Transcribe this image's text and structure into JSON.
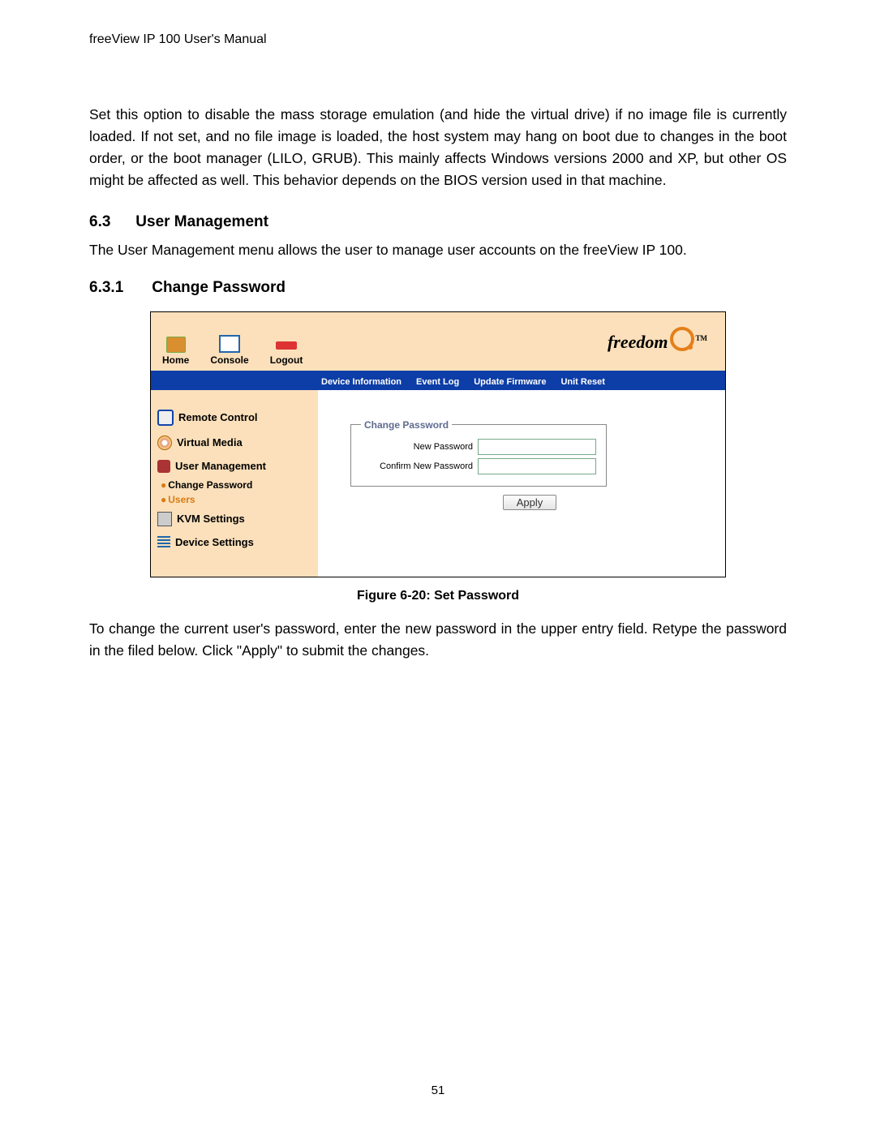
{
  "doc_header": "freeView IP 100 User's Manual",
  "para_intro": "Set this option to disable the mass storage emulation (and hide the virtual drive) if no image file is currently loaded. If not set, and no file image is loaded, the host system may hang on boot due to changes in the boot order, or the boot manager (LILO, GRUB). This mainly affects Windows versions 2000 and XP, but other OS might be affected as well. This behavior depends on the BIOS version used in that machine.",
  "section_63_num": "6.3",
  "section_63_title": "User Management",
  "para_63": "The User Management menu allows the user to manage user accounts on the freeView IP 100.",
  "section_631_num": "6.3.1",
  "section_631_title": "Change Password",
  "app": {
    "header_items": [
      "Home",
      "Console",
      "Logout"
    ],
    "brand": "freedom",
    "tm": "TM",
    "tabs": [
      "Device Information",
      "Event Log",
      "Update Firmware",
      "Unit Reset"
    ],
    "sidebar": {
      "items": [
        {
          "label": "Remote Control"
        },
        {
          "label": "Virtual Media"
        },
        {
          "label": "User Management"
        },
        {
          "label": "KVM Settings"
        },
        {
          "label": "Device Settings"
        }
      ],
      "sub_change_password": "Change Password",
      "sub_users": "Users"
    },
    "form": {
      "legend": "Change Password",
      "row1_label": "New Password",
      "row2_label": "Confirm New Password",
      "apply": "Apply"
    }
  },
  "figure_caption": "Figure 6-20: Set Password",
  "para_after": "To change the current user's password, enter the new password in the upper entry field. Retype the password in the filed below. Click \"Apply\" to submit the changes.",
  "page_number": "51"
}
